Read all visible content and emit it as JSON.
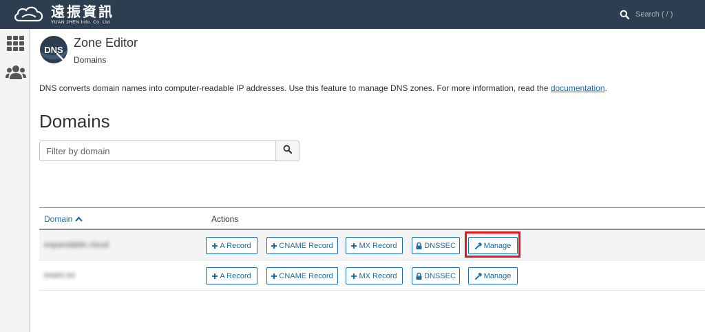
{
  "header": {
    "logo_cn": "遠振資訊",
    "logo_en": "YUAN JHEN Info. Co. Ltd",
    "search_placeholder": "Search ( / )"
  },
  "app": {
    "title": "Zone Editor",
    "subtitle": "Domains",
    "icon_label": "DNS"
  },
  "description": {
    "text": "DNS converts domain names into computer-readable IP addresses. Use this feature to manage DNS zones. For more information, read the ",
    "link": "documentation",
    "suffix": "."
  },
  "page_title": "Domains",
  "filter": {
    "placeholder": "Filter by domain",
    "value": ""
  },
  "table": {
    "col_domain": "Domain",
    "col_actions": "Actions",
    "sort": "ascending",
    "rows": [
      {
        "domain": "expandable.cloud",
        "actions": {
          "a": "A Record",
          "cname": "CNAME Record",
          "mx": "MX Record",
          "dnssec": "DNSSEC",
          "manage": "Manage"
        }
      },
      {
        "domain": "exam.ex",
        "actions": {
          "a": "A Record",
          "cname": "CNAME Record",
          "mx": "MX Record",
          "dnssec": "DNSSEC",
          "manage": "Manage"
        }
      }
    ]
  },
  "icons": {
    "topbar": [
      "cloud-logo-icon",
      "search-icon"
    ],
    "rail": [
      "apps-grid-icon",
      "users-icon"
    ],
    "buttons": [
      "plus-icon",
      "lock-icon",
      "wrench-icon"
    ],
    "header": [
      "sort-asc-icon"
    ]
  },
  "colors": {
    "topbar": "#2c3e50",
    "accent": "#1c6ea4",
    "highlight": "#e0171f"
  }
}
